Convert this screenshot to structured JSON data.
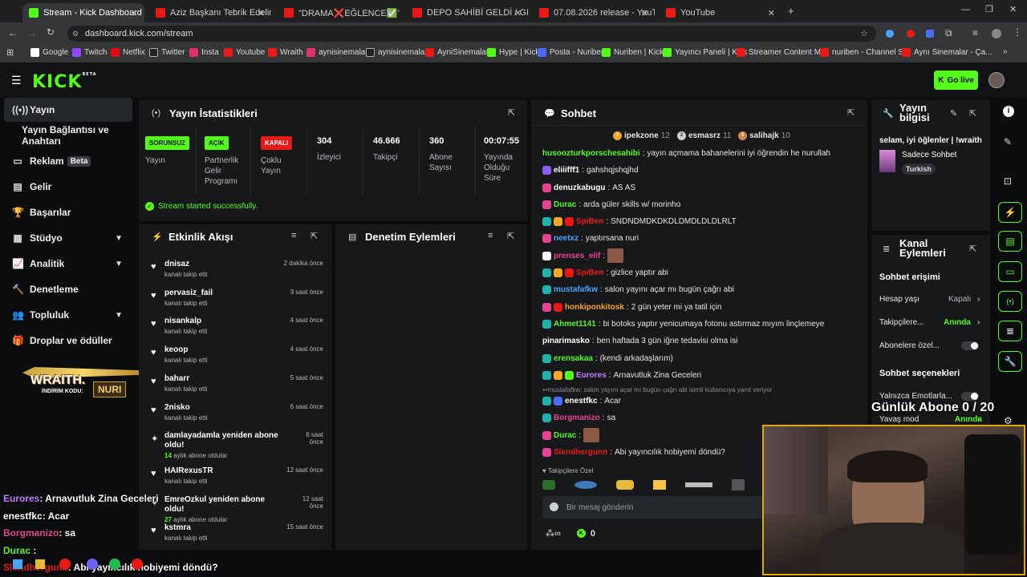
{
  "browser": {
    "tabs": [
      {
        "title": "Stream - Kick Dashboard",
        "active": true,
        "favicon": "kick-icon"
      },
      {
        "title": "Aziz Başkanı Tebrik Edelim | Yay",
        "favicon": "youtube-icon"
      },
      {
        "title": "\"DRAMA❌EĞLENCE✅\" Kick",
        "favicon": "youtube-icon"
      },
      {
        "title": "DEPO SAHİBİ GELDİ / GERGİNLİ",
        "favicon": "youtube-icon"
      },
      {
        "title": "07.08.2026 release - YouTube",
        "favicon": "youtube-icon"
      },
      {
        "title": "YouTube",
        "favicon": "youtube-icon"
      }
    ],
    "url": "dashboard.kick.com/stream",
    "bookmarks": [
      "Google",
      "Twitch",
      "Netflix",
      "Twitter",
      "Insta",
      "Youtube",
      "Wraith",
      "aynisinemalar",
      "aynisinemalar",
      "AyniSinemalar",
      "Hype | Kick",
      "Posta - Nuriben",
      "Nuriben | Kick",
      "Yayıncı Paneli | Kick",
      "Streamer Content M...",
      "nuriben - Channel S...",
      "Aynı Sinemalar - Ça..."
    ]
  },
  "header": {
    "logo": "KICK",
    "logo_sup": "BETA",
    "go_live": "Go live"
  },
  "sidebar": {
    "items": [
      {
        "label": "Yayın",
        "icon": "broadcast-icon",
        "active": true
      },
      {
        "label": "Yayın Bağlantısı ve Anahtarı"
      },
      {
        "label": "Reklam",
        "badge": "Beta",
        "icon": "tv-icon"
      },
      {
        "label": "Gelir",
        "icon": "bank-icon"
      },
      {
        "label": "Başarılar",
        "icon": "trophy-icon"
      },
      {
        "label": "Stüdyo",
        "icon": "layout-icon",
        "chevron": true
      },
      {
        "label": "Analitik",
        "icon": "chart-icon",
        "chevron": true
      },
      {
        "label": "Denetleme",
        "icon": "hammer-icon"
      },
      {
        "label": "Topluluk",
        "icon": "community-icon",
        "chevron": true
      },
      {
        "label": "Droplar ve ödüller",
        "icon": "gift-icon"
      }
    ],
    "promo": {
      "brand": "WRAITH.",
      "code_label": "İNDİRİM KODU:",
      "code": "NURI"
    }
  },
  "stats": {
    "title": "Yayın İstatistikleri",
    "columns": [
      {
        "badge": "SORUNSUZ",
        "badge_color": "#53fc18",
        "label": "Yayın"
      },
      {
        "badge": "AÇIK",
        "badge_color": "#53fc18",
        "label": "Partnerlik Gelir Programı"
      },
      {
        "badge": "KAPALI",
        "badge_color": "#e91916",
        "label": "Çoklu Yayın"
      },
      {
        "value": "304",
        "label": "İzleyici"
      },
      {
        "value": "46.666",
        "label": "Takipçi"
      },
      {
        "value": "360",
        "label": "Abone Sayısı"
      },
      {
        "value": "00:07:55",
        "label": "Yayında Olduğu Süre"
      }
    ],
    "success": "Stream started successfully."
  },
  "activity": {
    "title": "Etkinlik Akışı",
    "events": [
      {
        "name": "dnisaz",
        "sub": "kanalı takip etti",
        "time": "2 dakika önce"
      },
      {
        "name": "pervasiz_fail",
        "sub": "kanalı takip etti",
        "time": "3 saat önce"
      },
      {
        "name": "nisankalp",
        "sub": "kanalı takip etti",
        "time": "4 saat önce"
      },
      {
        "name": "keoop",
        "sub": "kanalı takip etti",
        "time": "4 saat önce"
      },
      {
        "name": "baharr",
        "sub": "kanalı takip etti",
        "time": "5 saat önce"
      },
      {
        "name": "2nisko",
        "sub": "kanalı takip etti",
        "time": "6 saat önce"
      },
      {
        "name": "damlayadamla yeniden abone oldu!",
        "sub_num": "14",
        "sub": "aylık abone oldular",
        "time": "6 saat önce"
      },
      {
        "name": "HAIRexusTR",
        "sub": "kanalı takip etti",
        "time": "12 saat önce"
      },
      {
        "name": "EmreOzkul yeniden abone oldu!",
        "sub_num": "27",
        "sub": "aylık abone oldular",
        "time": "12 saat önce"
      },
      {
        "name": "kstmra",
        "sub": "kanalı takip etti",
        "time": "15 saat önce"
      }
    ]
  },
  "moderation": {
    "title": "Denetim Eylemleri"
  },
  "chat": {
    "title": "Sohbet",
    "top_gifters": [
      {
        "name": "ipekzone",
        "count": "12",
        "color": "#f5a623"
      },
      {
        "name": "esmasrz",
        "count": "11",
        "color": "#cfcfcf"
      },
      {
        "name": "salihajk",
        "count": "10",
        "color": "#d2864a"
      }
    ],
    "messages": [
      {
        "user": "husoozturkporschesahibi",
        "color": "#53fc18",
        "text": "yayın açmama bahanelerini iyi öğrendin he nurullah"
      },
      {
        "user": "eliiifff1",
        "color": "#ffffff",
        "text": "gahshqjshqjhd",
        "badges": [
          "#8b5cf6"
        ]
      },
      {
        "user": "denuzkabugu",
        "color": "#ffffff",
        "text": "AS AS",
        "badges": [
          "#e84393"
        ]
      },
      {
        "user": "Durac",
        "color": "#53fc18",
        "text": "arda güler skills w/ morinho",
        "badges": [
          "#e84393"
        ]
      },
      {
        "user": "SpiBen",
        "color": "#e91916",
        "text": "SNDNDMDKDKDLDMDLDLDLRLT",
        "badges": [
          "#20b2aa",
          "#f5a623",
          "#e91916"
        ]
      },
      {
        "user": "neetxz",
        "color": "#4aa3ff",
        "text": "yaptırsana nuri",
        "badges": [
          "#e84393"
        ]
      },
      {
        "user": "prenses_elif",
        "color": "#e84393",
        "text": "",
        "badges": [
          "#ffffff"
        ]
      },
      {
        "user": "SpiBen",
        "color": "#e91916",
        "text": "gizlice yaptır abi",
        "badges": [
          "#20b2aa",
          "#f5a623",
          "#e91916"
        ]
      },
      {
        "user": "mustafafkw",
        "color": "#4aa3ff",
        "text": "salon yayını açar mı bugün çağrı abi",
        "badges": [
          "#20b2aa"
        ]
      },
      {
        "user": "honkiponkitosk",
        "color": "#f5a623",
        "text": "2 gün yeter mi ya tatil için",
        "badges": [
          "#e84393",
          "#e91916"
        ]
      },
      {
        "user": "Ahmet1141",
        "color": "#53fc18",
        "text": "bi botoks yaptır yenicumaya fotonu astırmaz mıyım linçlemeye",
        "badges": [
          "#20b2aa"
        ]
      },
      {
        "user": "pinarimasko",
        "color": "#ffffff",
        "text": "ben haftada 3 gün iğne tedavisi olma isi"
      },
      {
        "user": "erensakaa",
        "color": "#53fc18",
        "text": "(kendi arkadaşlarım)",
        "badges": [
          "#20b2aa"
        ]
      },
      {
        "user": "Eurores",
        "color": "#c77dff",
        "text": "Arnavutluk Zina Geceleri",
        "badges": [
          "#20b2aa",
          "#f5a623",
          "#53fc18"
        ]
      },
      {
        "reply": "mustafafkw: salon yayını açar mı bugün çağrı abi isimli kullanıcıya yanıt veriyor"
      },
      {
        "user": "enestfkc",
        "color": "#ffffff",
        "text": "Acar",
        "badges": [
          "#20b2aa",
          "#4a6cf7"
        ]
      },
      {
        "user": "Borgmanizo",
        "color": "#e84393",
        "text": "sa",
        "badges": [
          "#20b2aa"
        ]
      },
      {
        "user": "Durac",
        "color": "#53fc18",
        "text": "",
        "badges": [
          "#e84393"
        ]
      },
      {
        "user": "Slendhergunn",
        "color": "#e91916",
        "text": "Abi yayıncılık hobiyemi döndü?",
        "badges": [
          "#e84393"
        ]
      }
    ],
    "followers_only": "Takipçilere Özel",
    "input_placeholder": "Bir mesaj gönderin",
    "footer_count": "0"
  },
  "stream_info": {
    "title": "Yayın bilgisi",
    "stream_title": "selam, iyi öğlenler | !wraith",
    "category": "Sadece Sohbet",
    "tag": "Turkish"
  },
  "channel_actions": {
    "title": "Kanal Eylemleri",
    "chat_access": "Sohbet erişimi",
    "rows": [
      {
        "label": "Hesap yaşı",
        "value": "Kapalı"
      },
      {
        "label": "Takipçilere...",
        "value": "Anında"
      },
      {
        "label": "Abonelere özel...",
        "toggle": true
      }
    ],
    "chat_options": "Sohbet seçenekleri",
    "rows2": [
      {
        "label": "Yalnızca Emotlarla...",
        "toggle": true
      },
      {
        "label": "Yavaş mod",
        "value": "Anında"
      }
    ]
  },
  "overlay": {
    "sub_goal": "Günlük Abone 0 / 20",
    "chat": [
      {
        "user": "Eurores",
        "color": "#c77dff",
        "text": ": Arnavutluk Zina Geceleri"
      },
      {
        "user": "enestfkc",
        "color": "#ffffff",
        "text": ": Acar"
      },
      {
        "user": "Borgmanizo",
        "color": "#e84393",
        "text": ": sa"
      },
      {
        "user": "Durac",
        "color": "#53fc18",
        "text": " :"
      },
      {
        "user": "Slendhergunn",
        "color": "#e91916",
        "text": ": Abi yayıncılık hobiyemi döndü?"
      }
    ]
  },
  "colors": {
    "accent": "#53fc18",
    "panel": "#17181a",
    "bg": "#0b0c0d"
  }
}
